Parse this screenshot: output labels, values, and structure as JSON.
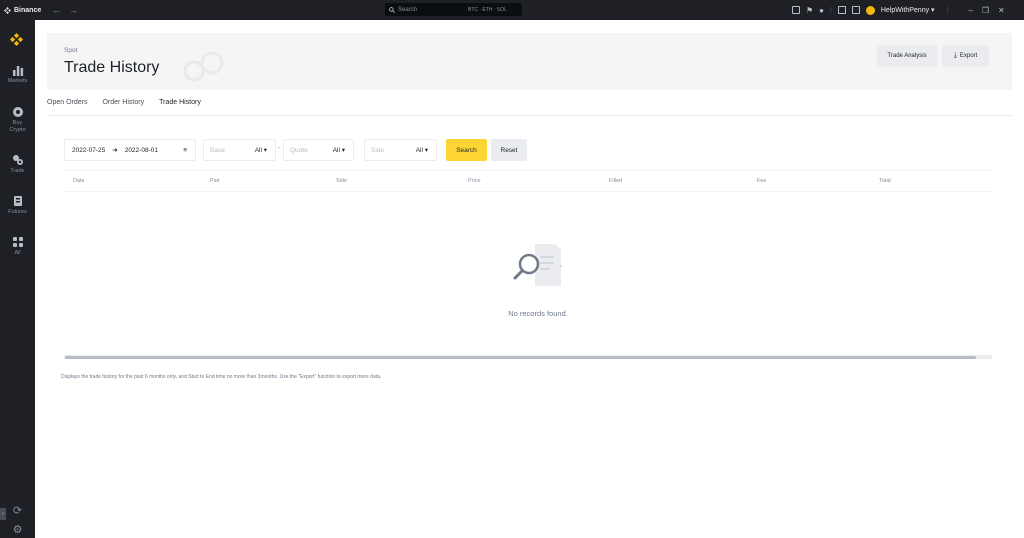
{
  "titlebar": {
    "app_name": "Binance",
    "back_icon": "arrow-left-icon",
    "forward_icon": "arrow-right-icon",
    "search_placeholder": "Search",
    "search_hint": "BTC · ETH · SOL",
    "username": "HelpWithPenny"
  },
  "sidebar": {
    "items": [
      {
        "label": "Markets",
        "icon": "bar-chart-icon"
      },
      {
        "label": "Buy Crypto",
        "icon": "buy-crypto-icon"
      },
      {
        "label": "Trade",
        "icon": "trade-icon"
      },
      {
        "label": "Futures",
        "icon": "futures-icon"
      },
      {
        "label": "All",
        "icon": "grid-icon"
      }
    ]
  },
  "page": {
    "subtitle": "Spot",
    "title": "Trade History",
    "trade_analysis_label": "Trade Analysis",
    "export_label": "Export"
  },
  "tabs": [
    {
      "label": "Open Orders",
      "active": false
    },
    {
      "label": "Order History",
      "active": false
    },
    {
      "label": "Trade History",
      "active": true
    }
  ],
  "filters": {
    "start_date": "2022-07-25",
    "end_date": "2022-08-01",
    "base_placeholder": "Base",
    "base_value": "All",
    "quote_placeholder": "Quote",
    "quote_value": "All",
    "side_placeholder": "Side",
    "side_value": "All",
    "separator": "-",
    "search_label": "Search",
    "reset_label": "Reset"
  },
  "table": {
    "columns": [
      "Date",
      "Pair",
      "Side",
      "Price",
      "Filled",
      "Fee",
      "Total"
    ],
    "rows": [],
    "empty_text": "No records found."
  },
  "footnote": "Displays the trade history for the past 6 months only, and Start to End time no more than 3months. Use the \"Export\" function to export more data.",
  "colors": {
    "accent": "#fcd535",
    "brand": "#f0b90b",
    "sidebar_bg": "#1e2026"
  }
}
